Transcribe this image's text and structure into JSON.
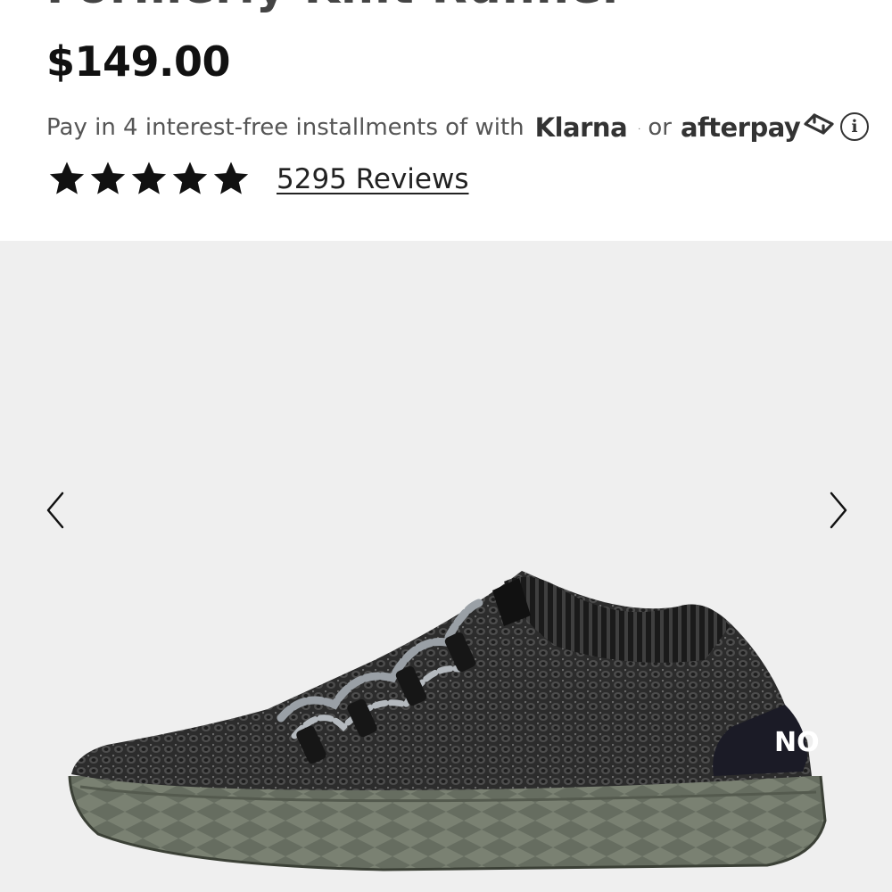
{
  "product": {
    "title": "Formerly Knit Runner",
    "price": "$149.00",
    "installments": {
      "text": "Pay in 4 interest-free installments of with",
      "klarna": "Klarna",
      "klarna_mark": ".",
      "or": "or",
      "afterpay": "afterpay"
    },
    "rating": {
      "stars": 5,
      "reviews_label": "5295 Reviews"
    }
  },
  "gallery": {
    "shoe_heel_text": "NO",
    "tongue_text": "NO",
    "prev_icon": "chevron-left-icon",
    "next_icon": "chevron-right-icon"
  },
  "icons": {
    "info": "i"
  },
  "colors": {
    "star": "#111111",
    "gallery_bg": "#efefef",
    "shoe_knit": "#3a3a3a",
    "shoe_sole": "#6b7264"
  }
}
